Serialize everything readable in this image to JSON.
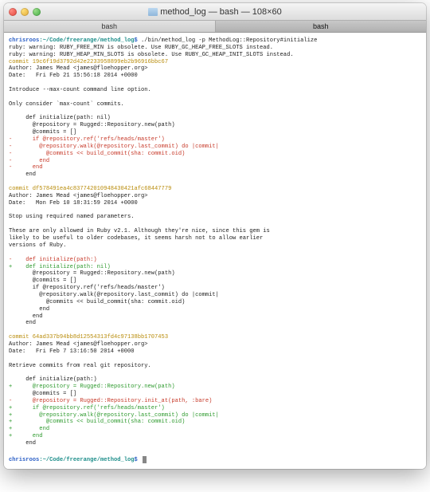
{
  "window": {
    "title": "method_log — bash — 108×60",
    "tabs": [
      "bash",
      "bash"
    ],
    "activeTab": 1
  },
  "prompt": {
    "user": "chrisroos",
    "sep": ":",
    "path": "~/Code/freerange/method_log",
    "dollar": "$"
  },
  "lines": [
    {
      "t": "prompt",
      "cmd": "./bin/method_log -p MethodLog::Repository#initialize"
    },
    {
      "t": "plain",
      "text": "ruby: warning: RUBY_FREE_MIN is obsolete. Use RUBY_GC_HEAP_FREE_SLOTS instead."
    },
    {
      "t": "plain",
      "text": "ruby: warning: RUBY_HEAP_MIN_SLOTS is obsolete. Use RUBY_GC_HEAP_INIT_SLOTS instead."
    },
    {
      "t": "yellow",
      "text": "commit 19c6f19d3792d42e2233958899eb2b96916bbc67"
    },
    {
      "t": "plain",
      "text": "Author: James Mead <james@floehopper.org>"
    },
    {
      "t": "plain",
      "text": "Date:   Fri Feb 21 15:56:18 2014 +0000"
    },
    {
      "t": "blank"
    },
    {
      "t": "plain",
      "text": "Introduce --max-count command line option."
    },
    {
      "t": "blank"
    },
    {
      "t": "plain",
      "text": "Only consider `max-count` commits."
    },
    {
      "t": "blank"
    },
    {
      "t": "plain",
      "text": "     def initialize(path: nil)"
    },
    {
      "t": "plain",
      "text": "       @repository = Rugged::Repository.new(path)"
    },
    {
      "t": "plain",
      "text": "       @commits = []"
    },
    {
      "t": "red",
      "text": "-      if @repository.ref('refs/heads/master')"
    },
    {
      "t": "red",
      "text": "-        @repository.walk(@repository.last_commit) do |commit|"
    },
    {
      "t": "red",
      "text": "-          @commits << build_commit(sha: commit.oid)"
    },
    {
      "t": "red",
      "text": "-        end"
    },
    {
      "t": "red",
      "text": "-      end"
    },
    {
      "t": "plain",
      "text": "     end"
    },
    {
      "t": "blank"
    },
    {
      "t": "yellow",
      "text": "commit df578491ea4c837742010948430421afc68447779"
    },
    {
      "t": "plain",
      "text": "Author: James Mead <james@floehopper.org>"
    },
    {
      "t": "plain",
      "text": "Date:   Mon Feb 10 18:31:59 2014 +0000"
    },
    {
      "t": "blank"
    },
    {
      "t": "plain",
      "text": "Stop using required named parameters."
    },
    {
      "t": "blank"
    },
    {
      "t": "plain",
      "text": "These are only allowed in Ruby v2.1. Although they're nice, since this gem is"
    },
    {
      "t": "plain",
      "text": "likely to be useful to older codebases, it seems harsh not to allow earlier"
    },
    {
      "t": "plain",
      "text": "versions of Ruby."
    },
    {
      "t": "blank"
    },
    {
      "t": "red",
      "text": "-    def initialize(path:)"
    },
    {
      "t": "green",
      "text": "+    def initialize(path: nil)"
    },
    {
      "t": "plain",
      "text": "       @repository = Rugged::Repository.new(path)"
    },
    {
      "t": "plain",
      "text": "       @commits = []"
    },
    {
      "t": "plain",
      "text": "       if @repository.ref('refs/heads/master')"
    },
    {
      "t": "plain",
      "text": "         @repository.walk(@repository.last_commit) do |commit|"
    },
    {
      "t": "plain",
      "text": "           @commits << build_commit(sha: commit.oid)"
    },
    {
      "t": "plain",
      "text": "         end"
    },
    {
      "t": "plain",
      "text": "       end"
    },
    {
      "t": "plain",
      "text": "     end"
    },
    {
      "t": "blank"
    },
    {
      "t": "yellow",
      "text": "commit 64ad337b94bb8d12554313fd4c97138bb1707453"
    },
    {
      "t": "plain",
      "text": "Author: James Mead <james@floehopper.org>"
    },
    {
      "t": "plain",
      "text": "Date:   Fri Feb 7 13:16:50 2014 +0000"
    },
    {
      "t": "blank"
    },
    {
      "t": "plain",
      "text": "Retrieve commits from real git repository."
    },
    {
      "t": "blank"
    },
    {
      "t": "plain",
      "text": "     def initialize(path:)"
    },
    {
      "t": "green",
      "text": "+      @repository = Rugged::Repository.new(path)"
    },
    {
      "t": "plain",
      "text": "       @commits = []"
    },
    {
      "t": "red",
      "text": "-      @repository = Rugged::Repository.init_at(path, :bare)"
    },
    {
      "t": "green",
      "text": "+      if @repository.ref('refs/heads/master')"
    },
    {
      "t": "green",
      "text": "+        @repository.walk(@repository.last_commit) do |commit|"
    },
    {
      "t": "green",
      "text": "+          @commits << build_commit(sha: commit.oid)"
    },
    {
      "t": "green",
      "text": "+        end"
    },
    {
      "t": "green",
      "text": "+      end"
    },
    {
      "t": "plain",
      "text": "     end"
    },
    {
      "t": "blank"
    },
    {
      "t": "prompt",
      "cmd": ""
    }
  ]
}
